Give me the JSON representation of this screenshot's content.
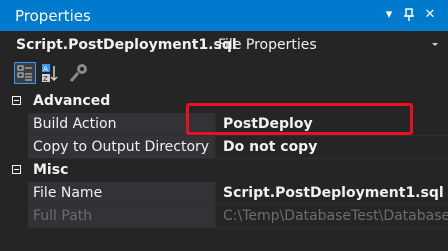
{
  "window": {
    "title": "Properties",
    "colors": {
      "titlebar": "#007acc",
      "background": "#252526",
      "name_column": "#333337",
      "highlight": "#e81123",
      "text": "#f1f1f1",
      "disabled_text": "#6d6d6d"
    }
  },
  "titlebar_controls": {
    "dropdown_icon": "chevron-down-icon",
    "pin_icon": "pin-icon",
    "close_icon": "close-icon",
    "dropdown_glyph": "▾",
    "pin_glyph": "‖",
    "close_glyph": "✕"
  },
  "object_selector": {
    "name": "Script.PostDeployment1.sql",
    "type": "File Properties"
  },
  "toolbar": {
    "buttons": [
      {
        "name": "categorized-icon",
        "active": true
      },
      {
        "name": "alphabetical-icon",
        "active": false
      },
      {
        "name": "property-pages-icon",
        "active": false
      }
    ]
  },
  "categories": [
    {
      "name": "Advanced",
      "properties": [
        {
          "name": "Build Action",
          "value": "PostDeploy",
          "enabled": true
        },
        {
          "name": "Copy to Output Directory",
          "value": "Do not copy",
          "enabled": true
        }
      ]
    },
    {
      "name": "Misc",
      "properties": [
        {
          "name": "File Name",
          "value": "Script.PostDeployment1.sql",
          "enabled": true
        },
        {
          "name": "Full Path",
          "value": "C:\\Temp\\DatabaseTest\\Database",
          "enabled": false
        }
      ]
    }
  ]
}
